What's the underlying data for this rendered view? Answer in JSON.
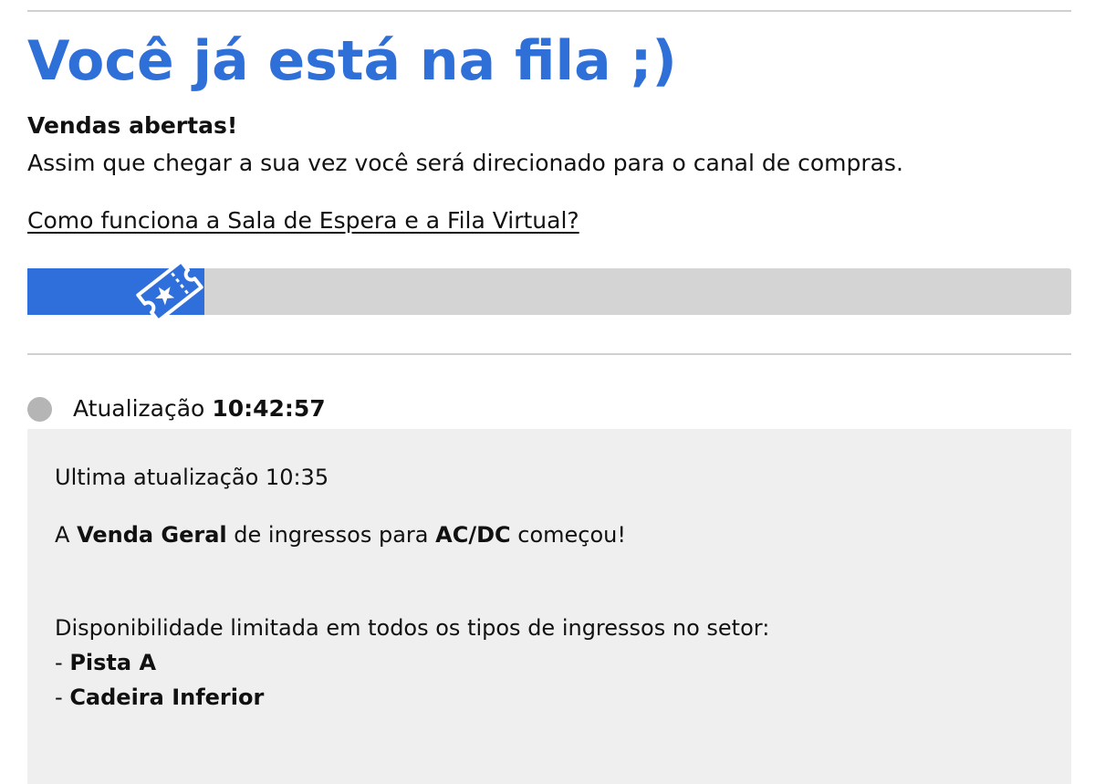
{
  "header": {
    "title": "Você já está na fila ;)",
    "subtitle": "Vendas abertas!",
    "description": "Assim que chegar a sua vez você será direcionado para o canal de compras.",
    "help_link": "Como funciona a Sala de Espera e a Fila Virtual?"
  },
  "progress": {
    "fraction": 0.17,
    "icon": "ticket-star-icon",
    "fill_color": "#2f6fdb",
    "track_color": "#d4d4d4"
  },
  "update": {
    "label": "Atualização",
    "time": "10:42:57",
    "status_color": "#b5b5b5"
  },
  "message": {
    "last_update": "Ultima atualização 10:35",
    "sale_line": {
      "prefix": "A",
      "event_type": "Venda Geral",
      "middle": "de ingressos para",
      "artist": "AC/DC",
      "suffix": "começou!"
    },
    "availability": "Disponibilidade limitada em todos os tipos de ingressos no setor:",
    "sectors": [
      {
        "dash": "-",
        "name": "Pista A"
      },
      {
        "dash": "-",
        "name": "Cadeira Inferior"
      }
    ]
  },
  "colors": {
    "accent": "#2f6fd8",
    "panel_background": "#efefef",
    "divider": "#d0d0d0"
  }
}
